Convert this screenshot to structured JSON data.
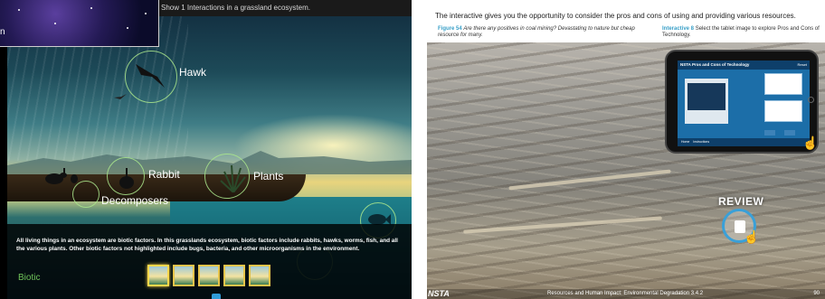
{
  "left": {
    "top_caption": "Show 1 Interactions in a grassland ecosystem.",
    "thumb_window_label": "n",
    "labels": {
      "hawk": "Hawk",
      "rabbit": "Rabbit",
      "plants": "Plants",
      "decomposers": "Decomposers"
    },
    "body_text": "All living things in an ecosystem are biotic factors. In this grasslands ecosystem, biotic factors include rabbits, hawks, worms, fish, and all the various plants. Other biotic factors not highlighted include bugs, bacteria, and other microorganisms in the environment.",
    "section_label": "Biotic",
    "thumbnails": 5,
    "selected_thumbnail": 1
  },
  "right": {
    "header": "The interactive gives you the opportunity to consider the pros and cons of using and providing various resources.",
    "figure_label": "Figure 54",
    "figure_caption": "Are there any positives in coal mining? Devastating to nature but cheap resource for many.",
    "interactive_label": "Interactive 8",
    "interactive_caption": "Select the tablet image to explore Pros and Cons of Technology.",
    "tablet": {
      "title": "NSTA  Pros and Cons of Technology",
      "reset": "Reset",
      "footer_left": "Home",
      "footer_right": "Instructions"
    },
    "review_label": "REVIEW",
    "footer_logo": "NSTA",
    "footer_text": "Resources and Human Impact: Environmental Degradation 3.4.2",
    "page_number": "90"
  }
}
